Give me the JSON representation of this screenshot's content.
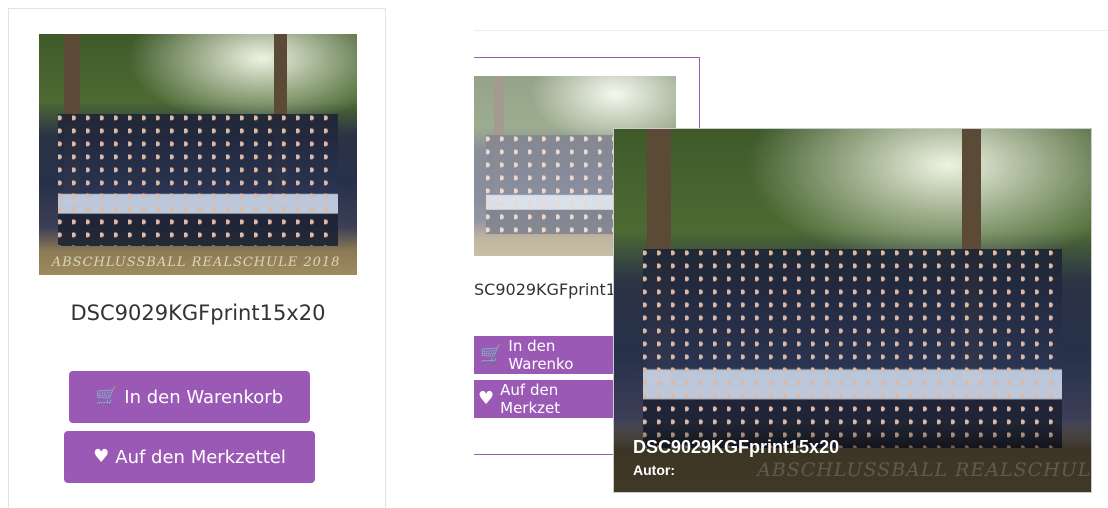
{
  "product": {
    "name": "DSC9029KGFprint15x20",
    "photo_caption": "ABSCHLUSSBALL REALSCHULE 2018",
    "cart_label": "In den Warenkorb",
    "wishlist_label": "Auf den Merkzettel",
    "cart_icon": "shopping-cart-icon",
    "wishlist_icon": "heart-icon"
  },
  "card_middle": {
    "name_partial": "SC9029KGFprint1",
    "cart_label_partial": "In den Warenko",
    "wishlist_label_partial": "Auf den Merkzet"
  },
  "preview": {
    "title": "DSC9029KGFprint15x20",
    "author_label": "Autor:"
  },
  "colors": {
    "accent": "#9b59b6",
    "text": "#333333"
  }
}
